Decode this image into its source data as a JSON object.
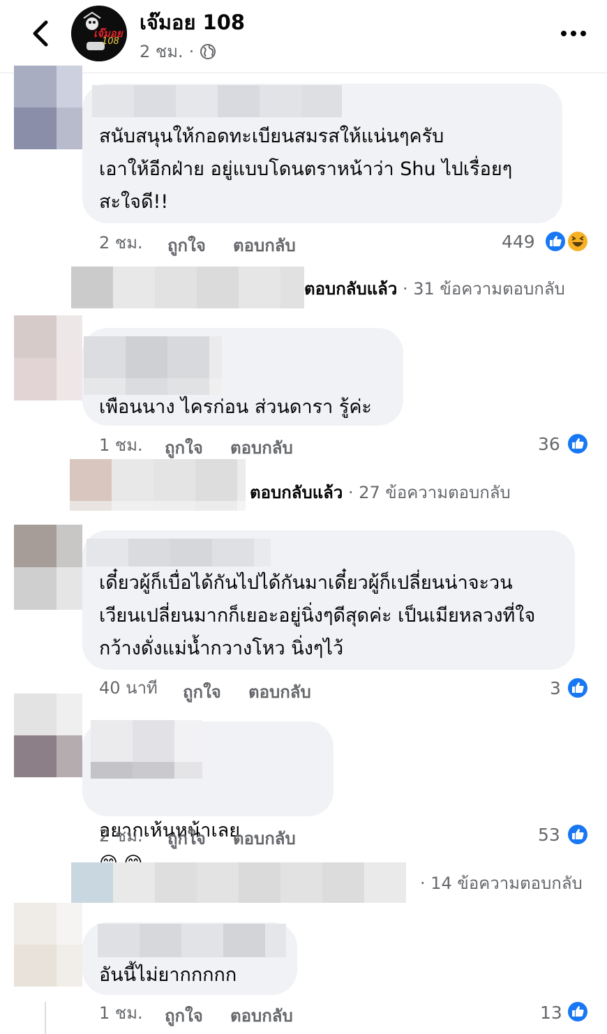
{
  "header": {
    "page_name": "เจ๊มอย 108",
    "time": "2 ชม.",
    "separator": "·",
    "logo_text": "เจ๊มอย",
    "logo_number": "108"
  },
  "action_labels": {
    "like": "ถูกใจ",
    "reply": "ตอบกลับ"
  },
  "comments": [
    {
      "text": "สนับสนุนให้กอดทะเบียนสมรสให้แน่นๆครับ\nเอาให้อีกฝ่าย อยู่แบบโดนตราหน้าว่า Shu ไปเรื่อยๆ\nสะใจดี!!",
      "time": "2 ชม.",
      "reaction_count": "449",
      "reactions": [
        "like-icon",
        "haha-icon"
      ],
      "reply_replied": "ตอบกลับแล้ว",
      "reply_count": "· 31 ข้อความตอบกลับ"
    },
    {
      "text": "เพือนนาง ไครก่อน ส่วนดารา รู้ค่ะ",
      "time": "1 ชม.",
      "reaction_count": "36",
      "reactions": [
        "like-icon"
      ],
      "reply_replied": "ตอบกลับแล้ว",
      "reply_count": "· 27 ข้อความตอบกลับ"
    },
    {
      "text": "เดี๋ยวผู้ก็เบื่อได้กันไปได้กันมาเดี๋ยวผู้ก็เปลี่ยนน่าจะวน\nเวียนเปลี่ยนมากก็เยอะอยู่นิ่งๆดีสุดค่ะ เป็นเมียหลวงที่ใจ\nกว้างดั่งแม่น้ำกวางโหว นิ่งๆไว้",
      "time": "40 นาที",
      "reaction_count": "3",
      "reactions": [
        "like-icon"
      ]
    },
    {
      "text": "อยากเห้นหน้าเลย",
      "emoji": "😁 😁",
      "time": "2 ชม.",
      "reaction_count": "53",
      "reactions": [
        "like-icon"
      ],
      "reply_count": "· 14 ข้อความตอบกลับ"
    },
    {
      "text": "อันนี้ไม่ยากกกกก",
      "time": "1 ชม.",
      "reaction_count": "13",
      "reactions": [
        "like-icon"
      ]
    }
  ],
  "colors": {
    "bubble": "#f0f2f5",
    "secondary_text": "#65676b",
    "like_blue": "#1877f2",
    "haha_yellow": "#f7b125"
  }
}
